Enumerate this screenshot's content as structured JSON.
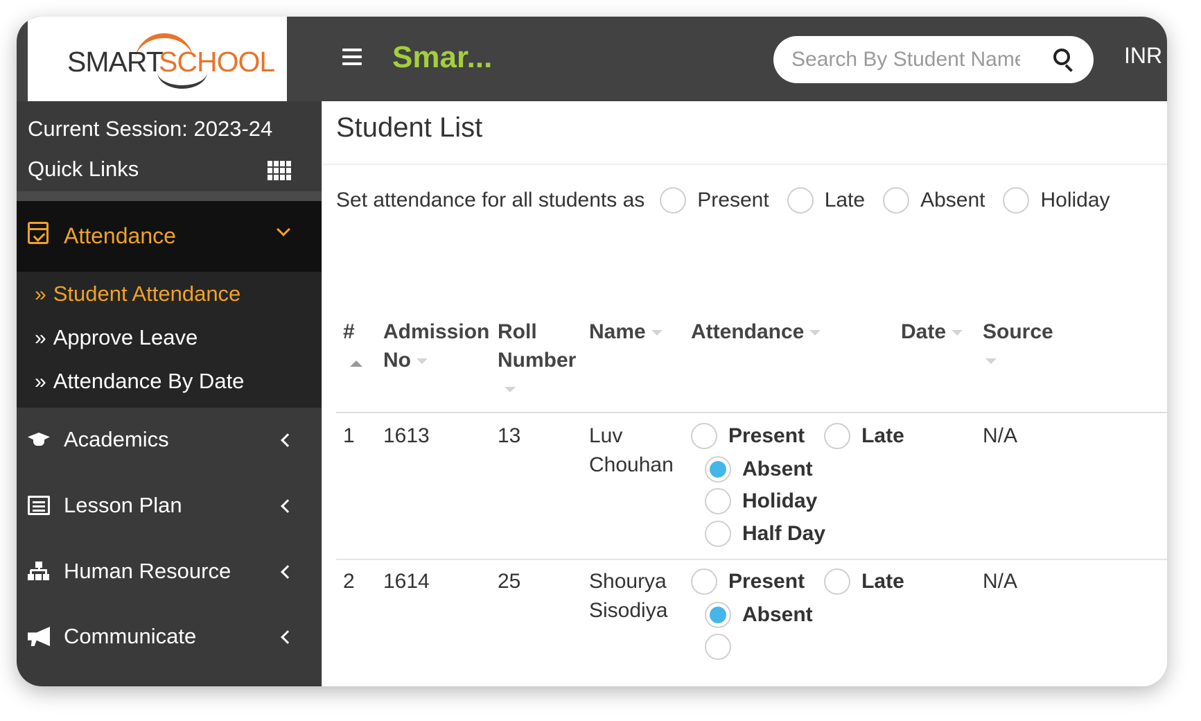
{
  "brand": {
    "logo_word1": "SMART",
    "logo_word2": "SCHOOL",
    "app_title": "Smar..."
  },
  "header": {
    "search_placeholder": "Search By Student Name",
    "currency": "INR"
  },
  "sidebar": {
    "session": "Current Session: 2023-24",
    "quick_links": "Quick Links",
    "active_section": "Attendance",
    "submenu": [
      "Student Attendance",
      "Approve Leave",
      "Attendance By Date"
    ],
    "items": [
      "Academics",
      "Lesson Plan",
      "Human Resource",
      "Communicate"
    ]
  },
  "main": {
    "title": "Student List",
    "set_all_label": "Set attendance for all students as",
    "set_all_options": [
      "Present",
      "Late",
      "Absent",
      "Holiday"
    ],
    "columns": {
      "num": "#",
      "admission": "Admission No",
      "roll": "Roll Number",
      "name": "Name",
      "attendance": "Attendance",
      "date": "Date",
      "source": "Source"
    },
    "rows": [
      {
        "num": "1",
        "admission": "1613",
        "roll": "13",
        "name_first": "Luv",
        "name_last": "Chouhan",
        "options": [
          "Present",
          "Late",
          "Absent",
          "Holiday",
          "Half Day"
        ],
        "selected": "Absent",
        "date": "",
        "source": "N/A"
      },
      {
        "num": "2",
        "admission": "1614",
        "roll": "25",
        "name_first": "Shourya",
        "name_last": "Sisodiya",
        "options": [
          "Present",
          "Late",
          "Absent"
        ],
        "selected": "Absent",
        "date": "",
        "source": "N/A"
      }
    ]
  },
  "colors": {
    "header_bg": "#424242",
    "sidebar_bg": "#3a3a3a",
    "accent_orange": "#f0a227",
    "title_green": "#a3cf3c",
    "radio_blue": "#45b6e8"
  },
  "icons": [
    "menu-icon",
    "search-icon",
    "grid-icon",
    "calendar-check-icon",
    "chevron-down-icon",
    "graduation-cap-icon",
    "list-icon",
    "sitemap-icon",
    "megaphone-icon",
    "chevron-left-icon"
  ]
}
